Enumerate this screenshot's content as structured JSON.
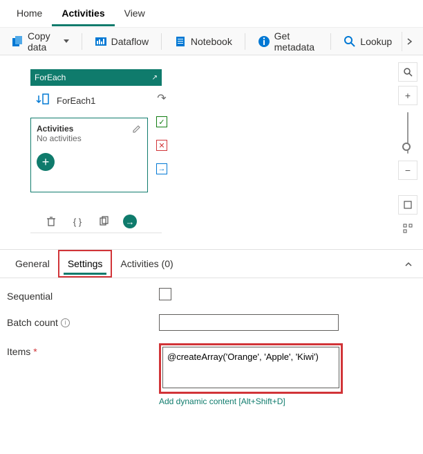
{
  "topnav": {
    "items": [
      "Home",
      "Activities",
      "View"
    ],
    "activeIndex": 1
  },
  "toolbar": {
    "copy_data": "Copy data",
    "dataflow": "Dataflow",
    "notebook": "Notebook",
    "get_metadata": "Get metadata",
    "lookup": "Lookup"
  },
  "node": {
    "type_label": "ForEach",
    "instance_name": "ForEach1",
    "activities_title": "Activities",
    "activities_sub": "No activities"
  },
  "tabs": {
    "general": "General",
    "settings": "Settings",
    "activities": "Activities (0)"
  },
  "settings": {
    "sequential_label": "Sequential",
    "batch_count_label": "Batch count",
    "batch_count_value": "",
    "items_label": "Items",
    "items_value": "@createArray('Orange', 'Apple', 'Kiwi')",
    "dynamic_link": "Add dynamic content [Alt+Shift+D]"
  }
}
